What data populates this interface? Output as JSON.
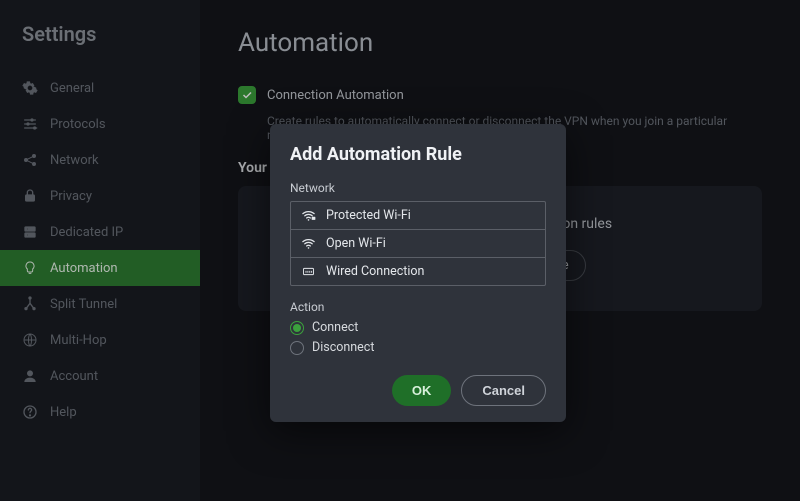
{
  "sidebar": {
    "title": "Settings",
    "items": [
      {
        "label": "General",
        "icon": "gear-icon"
      },
      {
        "label": "Protocols",
        "icon": "sliders-icon"
      },
      {
        "label": "Network",
        "icon": "share-icon"
      },
      {
        "label": "Privacy",
        "icon": "lock-icon"
      },
      {
        "label": "Dedicated IP",
        "icon": "server-icon"
      },
      {
        "label": "Automation",
        "icon": "bulb-icon"
      },
      {
        "label": "Split Tunnel",
        "icon": "branch-icon"
      },
      {
        "label": "Multi-Hop",
        "icon": "globe-icon"
      },
      {
        "label": "Account",
        "icon": "person-icon"
      },
      {
        "label": "Help",
        "icon": "help-icon"
      }
    ],
    "active_index": 5
  },
  "page": {
    "title": "Automation",
    "checkbox_label": "Connection Automation",
    "subtext": "Create rules to automatically connect or disconnect the VPN when you join a particular network.",
    "your_rules_label": "Your Automation Rules",
    "panel_text": "You don't have any automation rules",
    "add_button": "Add Automation Rule"
  },
  "modal": {
    "title": "Add Automation Rule",
    "network_label": "Network",
    "networks": [
      {
        "label": "Protected Wi-Fi",
        "icon": "wifi-lock-icon"
      },
      {
        "label": "Open Wi-Fi",
        "icon": "wifi-icon"
      },
      {
        "label": "Wired Connection",
        "icon": "ethernet-icon"
      }
    ],
    "action_label": "Action",
    "actions": {
      "connect": "Connect",
      "disconnect": "Disconnect",
      "selected": "connect"
    },
    "ok": "OK",
    "cancel": "Cancel"
  }
}
